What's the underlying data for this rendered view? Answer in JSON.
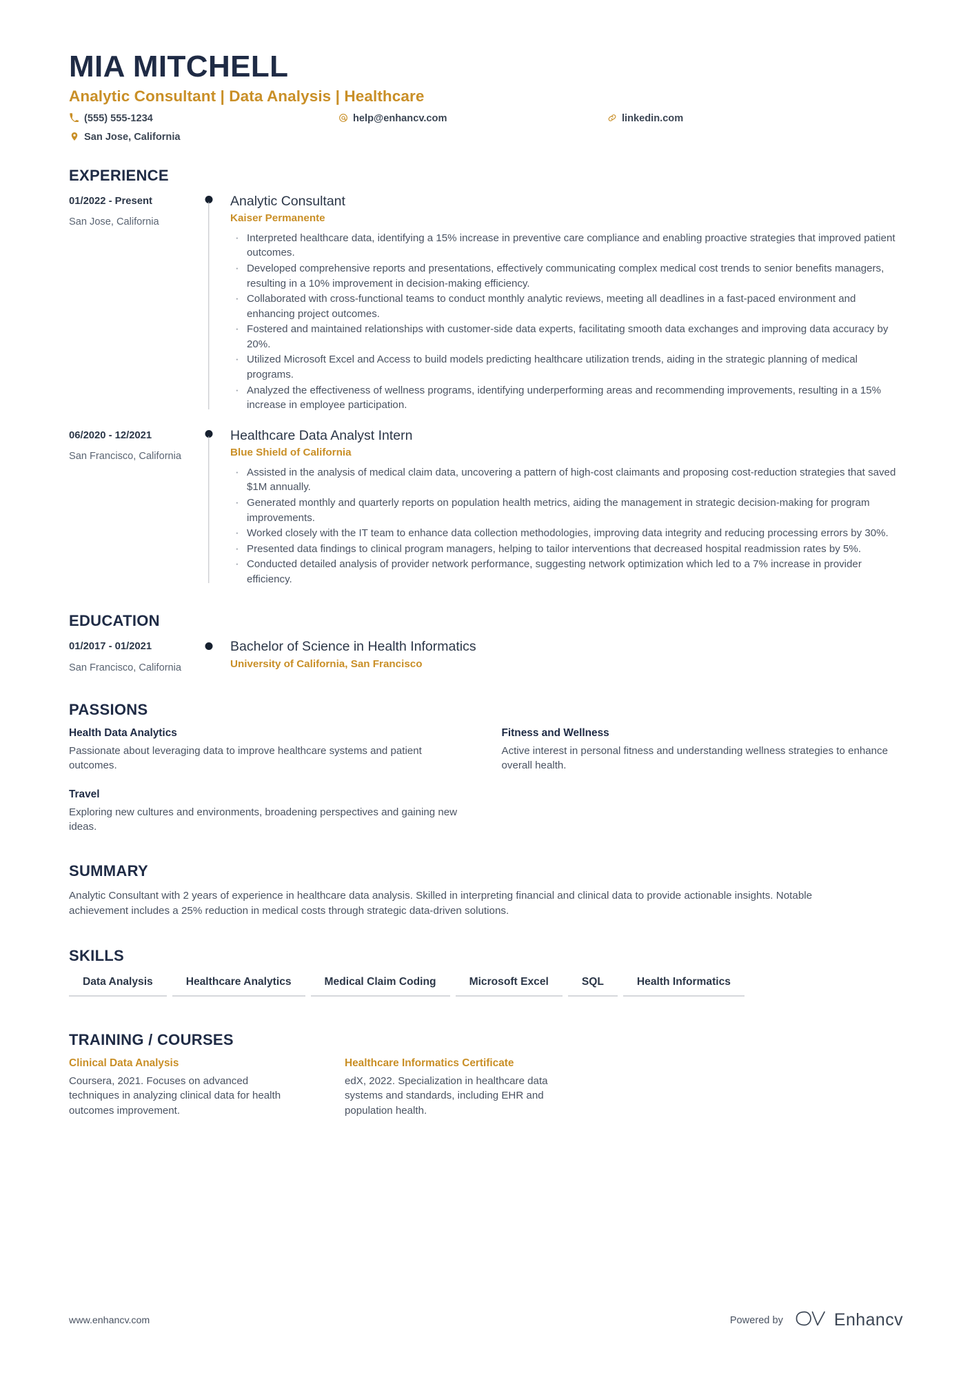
{
  "header": {
    "name": "MIA MITCHELL",
    "title": "Analytic Consultant | Data Analysis | Healthcare",
    "contacts": [
      {
        "icon": "phone-icon",
        "text": "(555) 555-1234"
      },
      {
        "icon": "email-icon",
        "text": "help@enhancv.com"
      },
      {
        "icon": "link-icon",
        "text": "linkedin.com"
      },
      {
        "icon": "location-icon",
        "text": "San Jose, California"
      }
    ]
  },
  "colors": {
    "accent_gold": "#c98f27",
    "navy": "#1f2b45",
    "body_text": "#4a5362",
    "rule": "#d6d8dc"
  },
  "experience": {
    "heading": "EXPERIENCE",
    "entries": [
      {
        "date": "01/2022 - Present",
        "location": "San Jose, California",
        "role": "Analytic Consultant",
        "organization": "Kaiser Permanente",
        "bullets": [
          "Interpreted healthcare data, identifying a 15% increase in preventive care compliance and enabling proactive strategies that improved patient outcomes.",
          "Developed comprehensive reports and presentations, effectively communicating complex medical cost trends to senior benefits managers, resulting in a 10% improvement in decision-making efficiency.",
          "Collaborated with cross-functional teams to conduct monthly analytic reviews, meeting all deadlines in a fast-paced environment and enhancing project outcomes.",
          "Fostered and maintained relationships with customer-side data experts, facilitating smooth data exchanges and improving data accuracy by 20%.",
          "Utilized Microsoft Excel and Access to build models predicting healthcare utilization trends, aiding in the strategic planning of medical programs.",
          "Analyzed the effectiveness of wellness programs, identifying underperforming areas and recommending improvements, resulting in a 15% increase in employee participation."
        ]
      },
      {
        "date": "06/2020 - 12/2021",
        "location": "San Francisco, California",
        "role": "Healthcare Data Analyst Intern",
        "organization": "Blue Shield of California",
        "bullets": [
          "Assisted in the analysis of medical claim data, uncovering a pattern of high-cost claimants and proposing cost-reduction strategies that saved $1M annually.",
          "Generated monthly and quarterly reports on population health metrics, aiding the management in strategic decision-making for program improvements.",
          "Worked closely with the IT team to enhance data collection methodologies, improving data integrity and reducing processing errors by 30%.",
          "Presented data findings to clinical program managers, helping to tailor interventions that decreased hospital readmission rates by 5%.",
          "Conducted detailed analysis of provider network performance, suggesting network optimization which led to a 7% increase in provider efficiency."
        ]
      }
    ]
  },
  "education": {
    "heading": "EDUCATION",
    "entries": [
      {
        "date": "01/2017 - 01/2021",
        "location": "San Francisco, California",
        "degree": "Bachelor of Science in Health Informatics",
        "institution": "University of California, San Francisco"
      }
    ]
  },
  "passions": {
    "heading": "PASSIONS",
    "items": [
      {
        "title": "Health Data Analytics",
        "description": "Passionate about leveraging data to improve healthcare systems and patient outcomes."
      },
      {
        "title": "Fitness and Wellness",
        "description": "Active interest in personal fitness and understanding wellness strategies to enhance overall health."
      },
      {
        "title": "Travel",
        "description": "Exploring new cultures and environments, broadening perspectives and gaining new ideas."
      }
    ]
  },
  "summary": {
    "heading": "SUMMARY",
    "text": "Analytic Consultant with 2 years of experience in healthcare data analysis. Skilled in interpreting financial and clinical data to provide actionable insights. Notable achievement includes a 25% reduction in medical costs through strategic data-driven solutions."
  },
  "skills": {
    "heading": "SKILLS",
    "items": [
      "Data Analysis",
      "Healthcare Analytics",
      "Medical Claim Coding",
      "Microsoft Excel",
      "SQL",
      "Health Informatics"
    ]
  },
  "training": {
    "heading": "TRAINING / COURSES",
    "items": [
      {
        "title": "Clinical Data Analysis",
        "description": "Coursera, 2021. Focuses on advanced techniques in analyzing clinical data for health outcomes improvement."
      },
      {
        "title": "Healthcare Informatics Certificate",
        "description": "edX, 2022. Specialization in healthcare data systems and standards, including EHR and population health."
      }
    ]
  },
  "footer": {
    "url": "www.enhancv.com",
    "powered_by": "Powered by",
    "brand": "Enhancv"
  }
}
